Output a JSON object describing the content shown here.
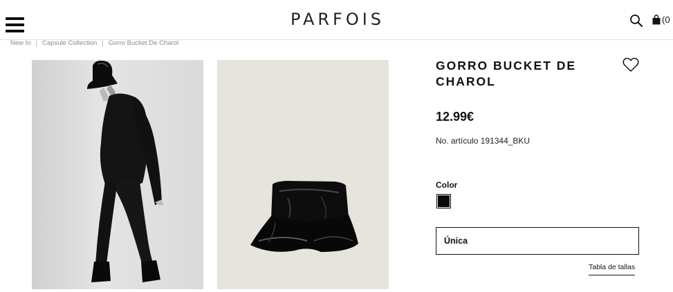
{
  "header": {
    "logo_text": "PARFOIS",
    "cart_count": "(0"
  },
  "breadcrumb": {
    "items": [
      "New In",
      "Capsule Collection",
      "Gorro Bucket De Charol"
    ],
    "separator": "|"
  },
  "product": {
    "title": "GORRO BUCKET DE CHAROL",
    "price": "12.99€",
    "article": "No. artículo 191344_BKU",
    "color_label": "Color",
    "color_swatch": "#0a0a0a",
    "size_value": "Única",
    "size_guide": "Tabla de tallas"
  },
  "icons": {
    "menu": "hamburger-menu-icon",
    "search": "search-icon",
    "cart": "shopping-bag-icon",
    "wishlist": "heart-icon"
  },
  "colors": {
    "text": "#111111",
    "muted": "#8a8a8a",
    "border": "#e3e3e3"
  }
}
